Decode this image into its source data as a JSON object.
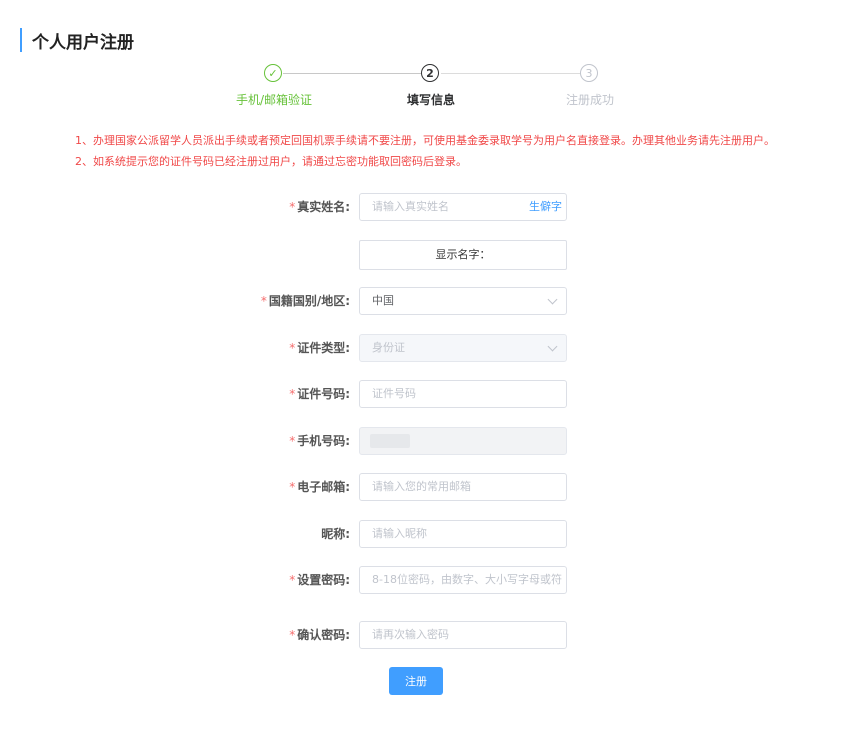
{
  "page": {
    "title": "个人用户注册"
  },
  "steps": [
    {
      "label": "手机/邮箱验证",
      "status": "done",
      "marker": "✓"
    },
    {
      "label": "填写信息",
      "status": "active",
      "marker": "2"
    },
    {
      "label": "注册成功",
      "status": "pending",
      "marker": "3"
    }
  ],
  "notices": [
    "1、办理国家公派留学人员派出手续或者预定回国机票手续请不要注册，可使用基金委录取学号为用户名直接登录。办理其他业务请先注册用户。",
    "2、如系统提示您的证件号码已经注册过用户，请通过忘密功能取回密码后登录。"
  ],
  "form": {
    "real_name": {
      "label": "真实姓名:",
      "required": "*",
      "placeholder": "请输入真实姓名",
      "link": "生僻字"
    },
    "display_name": {
      "label": "显示名字："
    },
    "nationality": {
      "label": "国籍国别/地区:",
      "required": "*",
      "value": "中国"
    },
    "id_type": {
      "label": "证件类型:",
      "required": "*",
      "value": "身份证"
    },
    "id_number": {
      "label": "证件号码:",
      "required": "*",
      "placeholder": "证件号码"
    },
    "phone": {
      "label": "手机号码:",
      "required": "*"
    },
    "email": {
      "label": "电子邮箱:",
      "required": "*",
      "placeholder": "请输入您的常用邮箱"
    },
    "nickname": {
      "label": "昵称:",
      "placeholder": "请输入昵称"
    },
    "password": {
      "label": "设置密码:",
      "required": "*",
      "placeholder": "8-18位密码，由数字、大小写字母或符"
    },
    "confirm_password": {
      "label": "确认密码:",
      "required": "*",
      "placeholder": "请再次输入密码"
    },
    "submit_label": "注册"
  },
  "colors": {
    "accent": "#409eff",
    "success": "#67c23a",
    "notice": "#f04848",
    "required": "#f56c6c"
  }
}
